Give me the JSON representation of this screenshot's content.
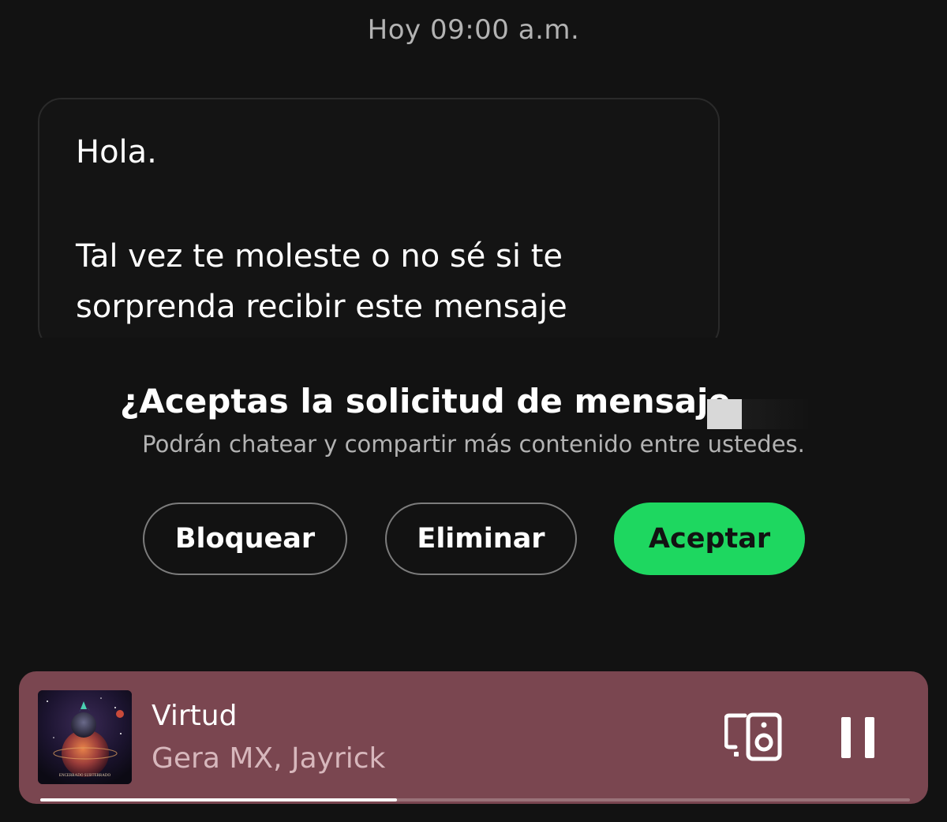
{
  "chat": {
    "timestamp": "Hoy 09:00 a.m.",
    "message_lines": [
      "Hola.",
      "Tal vez te moleste o no sé si te",
      "sorprenda recibir este mensaje"
    ]
  },
  "request": {
    "title": "¿Aceptas la solicitud de mensaje",
    "subtitle": "Podrán chatear y compartir más contenido entre ustedes.",
    "buttons": {
      "block": "Bloquear",
      "delete": "Eliminar",
      "accept": "Aceptar"
    }
  },
  "player": {
    "track_title": "Virtud",
    "artist": "Gera MX, Jayrick",
    "progress": 0.41,
    "devices_icon": "speaker-devices-icon",
    "pause_icon": "pause-icon"
  },
  "colors": {
    "accent": "#1ed760",
    "player_bg": "#7a4650",
    "background": "#121212"
  }
}
